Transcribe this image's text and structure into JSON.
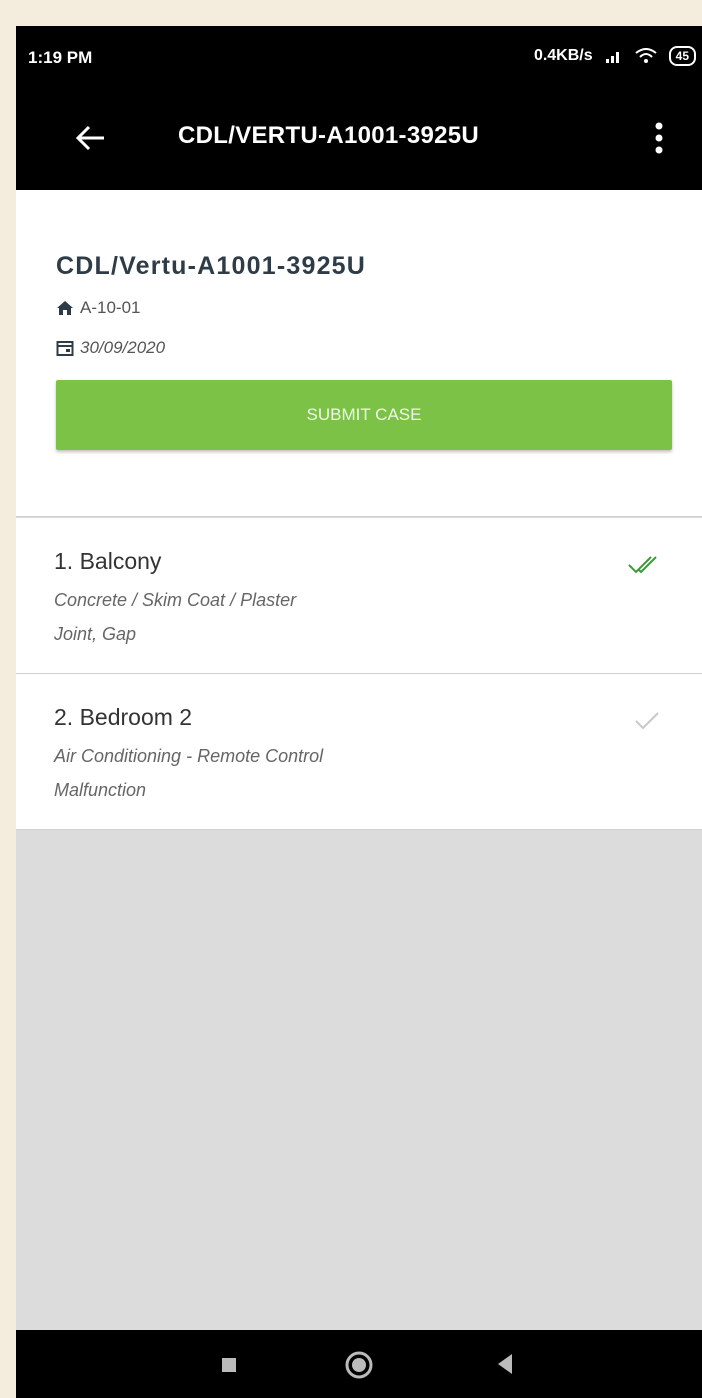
{
  "status_bar": {
    "time": "1:19 PM",
    "network_speed": "0.4KB/s",
    "battery": "45"
  },
  "app_bar": {
    "title": "CDL/VERTU-A1001-3925U",
    "back_icon": "arrow-left-icon",
    "menu_icon": "more-vertical-icon"
  },
  "case": {
    "title": "CDL/Vertu-A1001-3925U",
    "unit": "A-10-01",
    "date": "30/09/2020",
    "submit_label": "SUBMIT CASE"
  },
  "items": [
    {
      "title": "1. Balcony",
      "category": "Concrete / Skim Coat / Plaster",
      "issue": "Joint, Gap",
      "status_icon": "double-check-icon"
    },
    {
      "title": "2. Bedroom 2",
      "category": "Air Conditioning - Remote Control",
      "issue": "Malfunction",
      "status_icon": "check-icon"
    }
  ],
  "colors": {
    "accent_green": "#7cc247",
    "check_green": "#3a9a3a",
    "check_grey": "#c8c8c8",
    "title_dark": "#2e3c48"
  }
}
